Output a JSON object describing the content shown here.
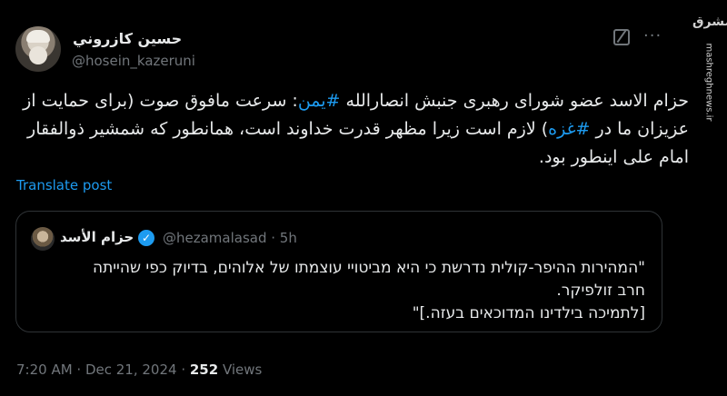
{
  "author": {
    "display_name": "حسين كازروني",
    "handle": "@hosein_kazeruni"
  },
  "watermark": {
    "logo": "مشرق",
    "site": "mashreghnews.ir"
  },
  "tweet": {
    "text_part1": "حزام الاسد عضو شورای رهبری جنبش انصارالله ",
    "hashtag1": "#یمن",
    "text_part2": ": سرعت مافوق صوت  (برای حمایت از عزیزان ما در ",
    "hashtag2": "#غزه",
    "text_part3": ") لازم است زیرا مظهر قدرت خداوند است، همانطور که شمشیر ذوالفقار امام علی اینطور بود."
  },
  "translate_label": "Translate post",
  "quote": {
    "name": "حزام الأسد",
    "verified_icon": "✓",
    "handle_time": "@hezamalasad · 5h",
    "line1": "\"המהירות ההיפר-קולית נדרשת כי היא מביטויי עוצמתו של אלוהים, בדיוק כפי שהייתה",
    "line2": "חרב זולפיקר.",
    "line3": "[לתמיכה בילדינו המדוכאים בעזה.]\""
  },
  "meta": {
    "timestamp": "7:20 AM · Dec 21, 2024 · ",
    "views_count": "252",
    "views_label": " Views"
  },
  "icons": {
    "more": "···",
    "grok": "grok-icon"
  }
}
